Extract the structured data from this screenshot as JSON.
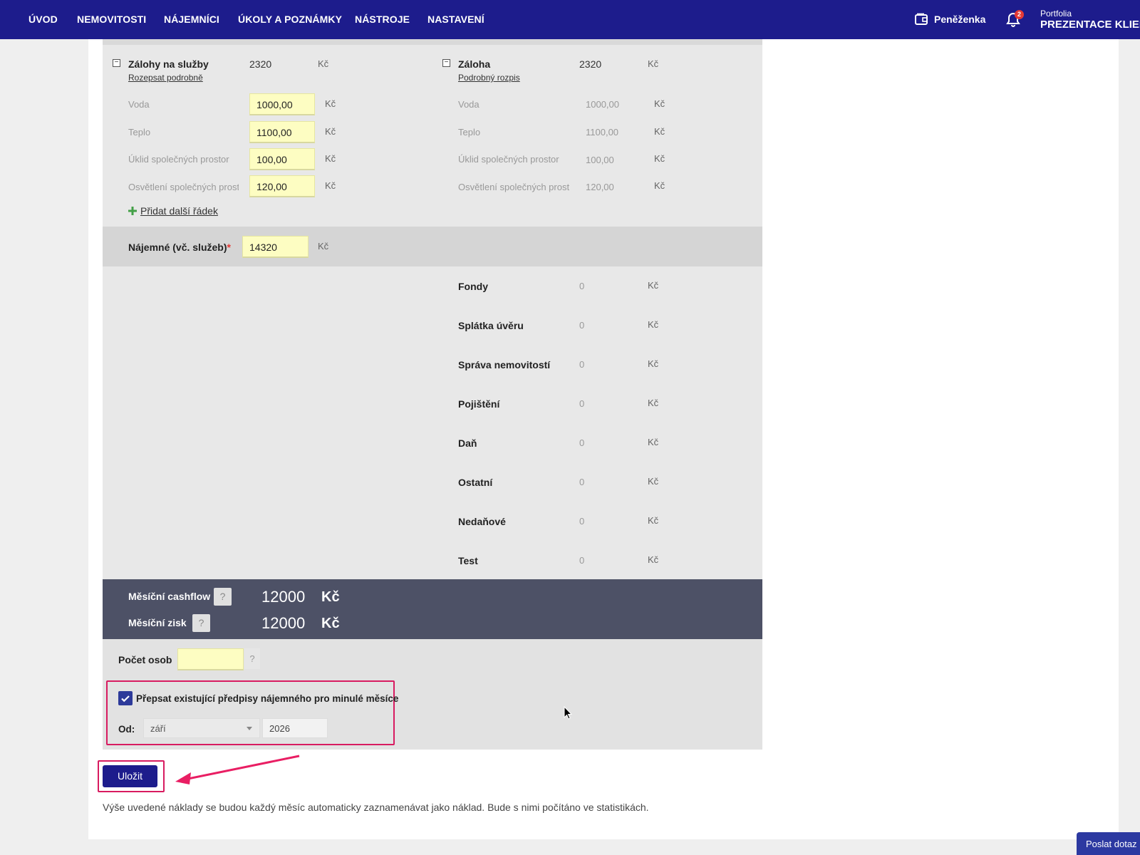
{
  "nav": {
    "items": [
      "ÚVOD",
      "NEMOVITOSTI",
      "NÁJEMNÍCI",
      "ÚKOLY A POZNÁMKY",
      "NÁSTROJE",
      "NASTAVENÍ"
    ],
    "wallet_label": "Peněženka",
    "notification_count": "2",
    "portfolio_label": "Portfolia",
    "portfolio_value": "PREZENTACE KLIENTI"
  },
  "left": {
    "title": "Zálohy na služby",
    "link": "Rozepsat podrobně",
    "total": "2320",
    "unit": "Kč",
    "rows": [
      {
        "label": "Voda",
        "value": "1000,00"
      },
      {
        "label": "Teplo",
        "value": "1100,00"
      },
      {
        "label": "Úklid společných prostor",
        "value": "100,00"
      },
      {
        "label": "Osvětlení společných prostor",
        "value": "120,00"
      }
    ],
    "add_row": "Přidat další řádek"
  },
  "right": {
    "title": "Záloha",
    "link": "Podrobný rozpis",
    "total": "2320",
    "rows": [
      {
        "label": "Voda",
        "value": "1000,00"
      },
      {
        "label": "Teplo",
        "value": "1100,00"
      },
      {
        "label": "Úklid společných prostor",
        "value": "100,00"
      },
      {
        "label": "Osvětlení společných prostor",
        "value": "120,00"
      }
    ],
    "costs": [
      {
        "label": "Fondy",
        "value": "0"
      },
      {
        "label": "Splátka úvěru",
        "value": "0"
      },
      {
        "label": "Správa nemovitostí",
        "value": "0"
      },
      {
        "label": "Pojištění",
        "value": "0"
      },
      {
        "label": "Daň",
        "value": "0"
      },
      {
        "label": "Ostatní",
        "value": "0"
      },
      {
        "label": "Nedaňové",
        "value": "0"
      },
      {
        "label": "Test",
        "value": "0"
      }
    ]
  },
  "rent": {
    "label": "Nájemné (vč. služeb)",
    "required_mark": "*",
    "value": "14320"
  },
  "summary": {
    "cashflow_label": "Měsíční cashflow",
    "cashflow_value": "12000",
    "profit_label": "Měsíční zisk",
    "profit_value": "12000",
    "help": "?"
  },
  "persons": {
    "label": "Počet osob",
    "value": "",
    "help": "?"
  },
  "overwrite": {
    "checked": true,
    "label": "Přepsat existující předpisy nájemného pro minulé měsíce",
    "from_label": "Od:",
    "month": "září",
    "year": "2026"
  },
  "save_label": "Uložit",
  "footnote": "Výše uvedené náklady se budou každý měsíc automaticky zaznamenávat jako náklad. Bude s nimi počítáno ve statistikách.",
  "help_tab": "Poslat dotaz",
  "colors": {
    "nav": "#1d1c8c",
    "accent": "#d81b60",
    "summary_band": "#4d5166",
    "input_bg": "#fdfdc2"
  }
}
